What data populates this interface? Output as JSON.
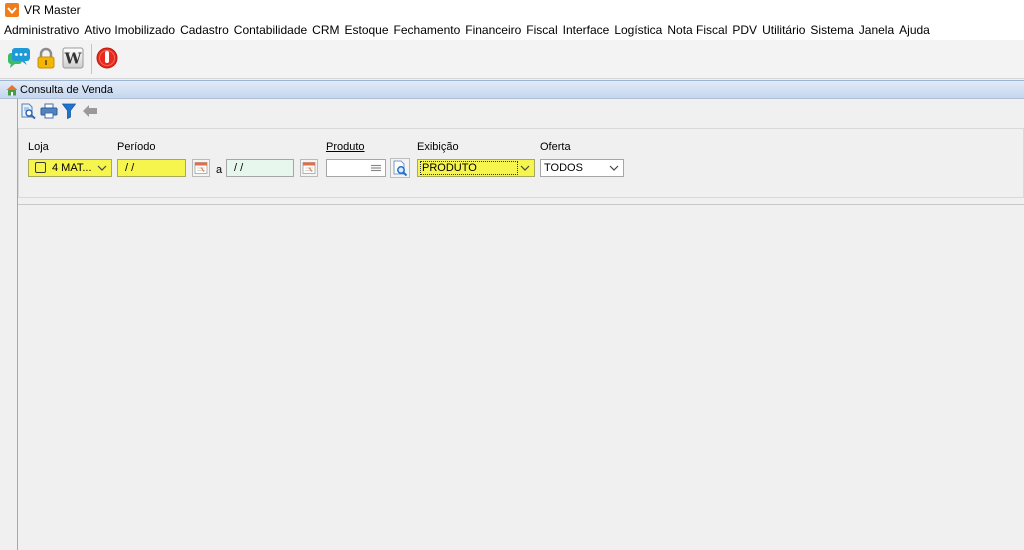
{
  "window": {
    "title": "VR Master"
  },
  "menu": [
    "Administrativo",
    "Ativo Imobilizado",
    "Cadastro",
    "Contabilidade",
    "CRM",
    "Estoque",
    "Fechamento",
    "Financeiro",
    "Fiscal",
    "Interface",
    "Logística",
    "Nota Fiscal",
    "PDV",
    "Utilitário",
    "Sistema",
    "Janela",
    "Ajuda"
  ],
  "toolbar": {
    "icons": [
      "chat-icon",
      "lock-icon",
      "word-icon",
      "power-icon"
    ],
    "word_glyph": "W"
  },
  "frame": {
    "title": "Consulta de Venda",
    "toolbar_icons": [
      "search-document-icon",
      "print-icon",
      "filter-icon",
      "back-arrow-icon"
    ]
  },
  "filters": {
    "loja": {
      "label": "Loja",
      "value": "4 MAT...",
      "checked": false
    },
    "periodo": {
      "label": "Período",
      "start": "/ /",
      "separator": "a",
      "end": "/ /"
    },
    "produto": {
      "label": "Produto"
    },
    "exibicao": {
      "label": "Exibição",
      "value": "PRODUTO"
    },
    "oferta": {
      "label": "Oferta",
      "value": "TODOS"
    }
  },
  "colors": {
    "required_field": "#f5f54d",
    "date_end_field": "#e8f7ee",
    "frame_title_bar": "#c4d6ee",
    "app_icon": "#f07d1a",
    "power_button": "#e8291c",
    "filter_icon": "#1f74d0"
  }
}
